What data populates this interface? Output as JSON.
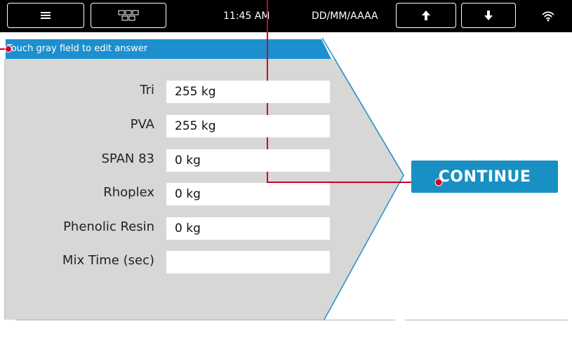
{
  "status_bar": {
    "time": "11:45 AM",
    "date": "DD/MM/AAAA",
    "menu_icon": "hamburger-menu",
    "grid_icon": "grid-layout",
    "up_icon": "arrow-up",
    "down_icon": "arrow-down",
    "wifi_icon": "wifi"
  },
  "hint": "Touch gray field to edit answer",
  "form": {
    "rows": [
      {
        "label": "Tri",
        "value": "255 kg"
      },
      {
        "label": "PVA",
        "value": "255 kg"
      },
      {
        "label": "SPAN 83",
        "value": "0 kg"
      },
      {
        "label": "Rhoplex",
        "value": "0 kg"
      },
      {
        "label": "Phenolic Resin",
        "value": "0 kg"
      },
      {
        "label": "Mix Time (sec)",
        "value": ""
      }
    ]
  },
  "continue_label": "CONTINUE",
  "colors": {
    "topbar": "#000000",
    "hint_bar": "#1c8fcf",
    "form_panel": "#d7d7d5",
    "continue_button": "#1890c3",
    "annotation_line": "#d00020"
  }
}
